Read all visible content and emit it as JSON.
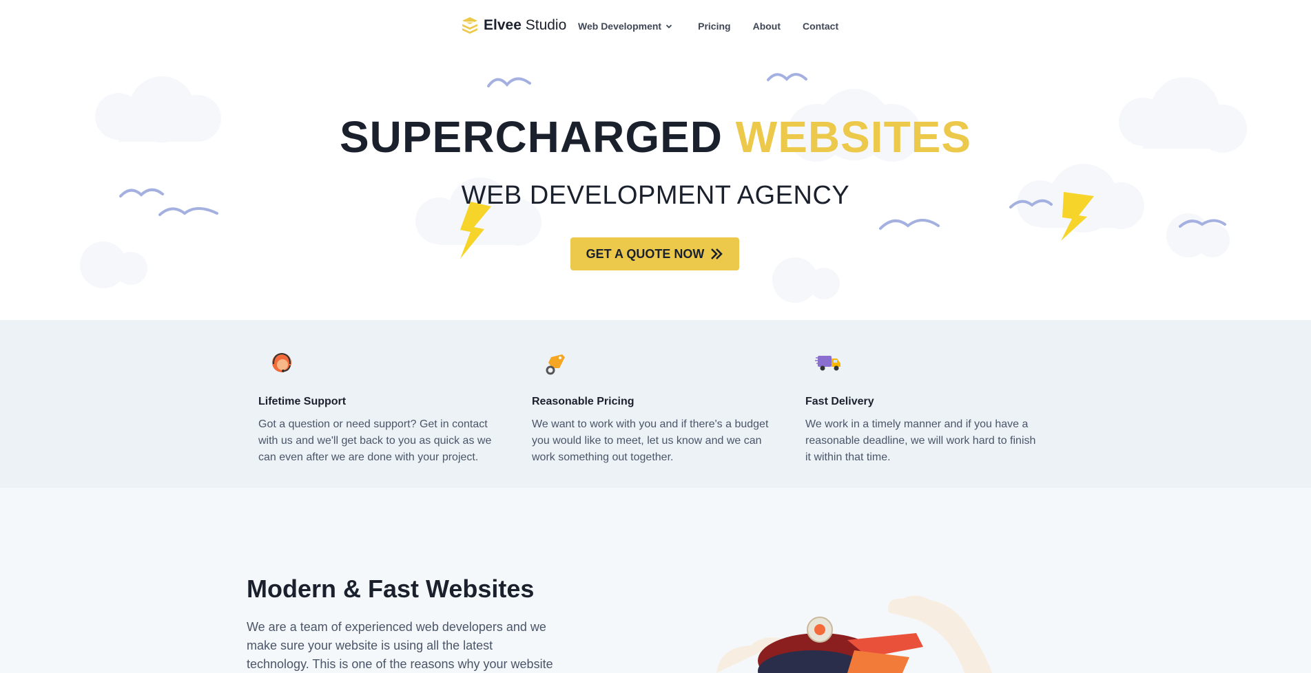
{
  "nav": {
    "brand_bold": "Elvee",
    "brand_light": "Studio",
    "items": [
      {
        "label": "Web Development",
        "dropdown": true
      },
      {
        "label": "Pricing"
      },
      {
        "label": "About"
      },
      {
        "label": "Contact"
      }
    ]
  },
  "hero": {
    "title_main": "SUPERCHARGED",
    "title_accent": "WEBSITES",
    "subtitle": "WEB DEVELOPMENT AGENCY",
    "cta_label": "GET A QUOTE NOW"
  },
  "features": [
    {
      "icon": "support-agent-icon",
      "title": "Lifetime Support",
      "description": "Got a question or need support? Get in contact with us and we'll get back to you as quick as we can even after we are done with your project."
    },
    {
      "icon": "price-tag-icon",
      "title": "Reasonable Pricing",
      "description": "We want to work with you and if there's a budget you would like to meet, let us know and we can work something out together."
    },
    {
      "icon": "delivery-truck-icon",
      "title": "Fast Delivery",
      "description": "We work in a timely manner and if you have a reasonable deadline, we will work hard to finish it within that time."
    }
  ],
  "modern": {
    "title": "Modern & Fast Websites",
    "text": "We are a team of experienced web developers and we make sure your website is using all the latest technology. This is one of the reasons why your website"
  },
  "colors": {
    "accent": "#ecc94b",
    "dark": "#1a202c",
    "features_bg": "#edf2f7",
    "cloud": "#f5f7fb",
    "bird": "#a3b0e0"
  }
}
